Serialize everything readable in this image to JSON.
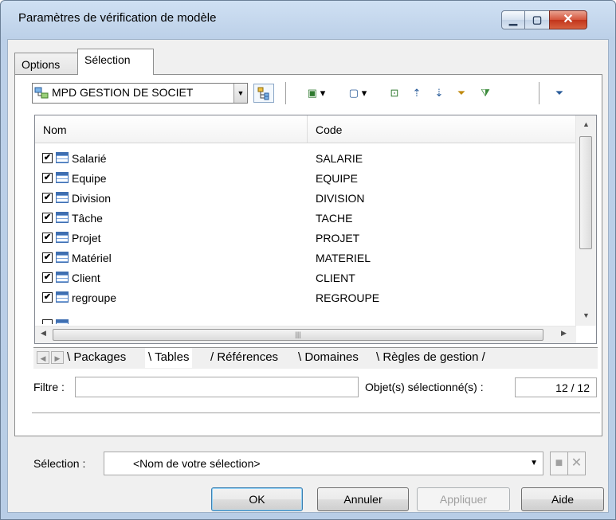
{
  "window": {
    "title": "Paramètres de vérification de modèle"
  },
  "tabs": [
    {
      "label": "Options"
    },
    {
      "label": "Sélection"
    }
  ],
  "model_selector": {
    "value": "MPD GESTION DE SOCIET"
  },
  "list": {
    "columns": {
      "name": "Nom",
      "code": "Code"
    },
    "rows": [
      {
        "name": "Salarié",
        "code": "SALARIE",
        "checked": true
      },
      {
        "name": "Equipe",
        "code": "EQUIPE",
        "checked": true
      },
      {
        "name": "Division",
        "code": "DIVISION",
        "checked": true
      },
      {
        "name": "Tâche",
        "code": "TACHE",
        "checked": true
      },
      {
        "name": "Projet",
        "code": "PROJET",
        "checked": true
      },
      {
        "name": "Matériel",
        "code": "MATERIEL",
        "checked": true
      },
      {
        "name": "Client",
        "code": "CLIENT",
        "checked": true
      },
      {
        "name": "regroupe",
        "code": "REGROUPE",
        "checked": true
      }
    ]
  },
  "sheet_tabs": [
    {
      "label": "Packages"
    },
    {
      "label": "Tables"
    },
    {
      "label": "Références"
    },
    {
      "label": "Domaines"
    },
    {
      "label": "Règles de gestion"
    }
  ],
  "filter": {
    "label": "Filtre :",
    "value": ""
  },
  "selected_objects": {
    "label": "Objet(s) sélectionné(s) :",
    "value": "12 / 12"
  },
  "selection": {
    "label": "Sélection :",
    "value": "<Nom de votre sélection>"
  },
  "buttons": {
    "ok": "OK",
    "cancel": "Annuler",
    "apply": "Appliquer",
    "help": "Aide"
  }
}
